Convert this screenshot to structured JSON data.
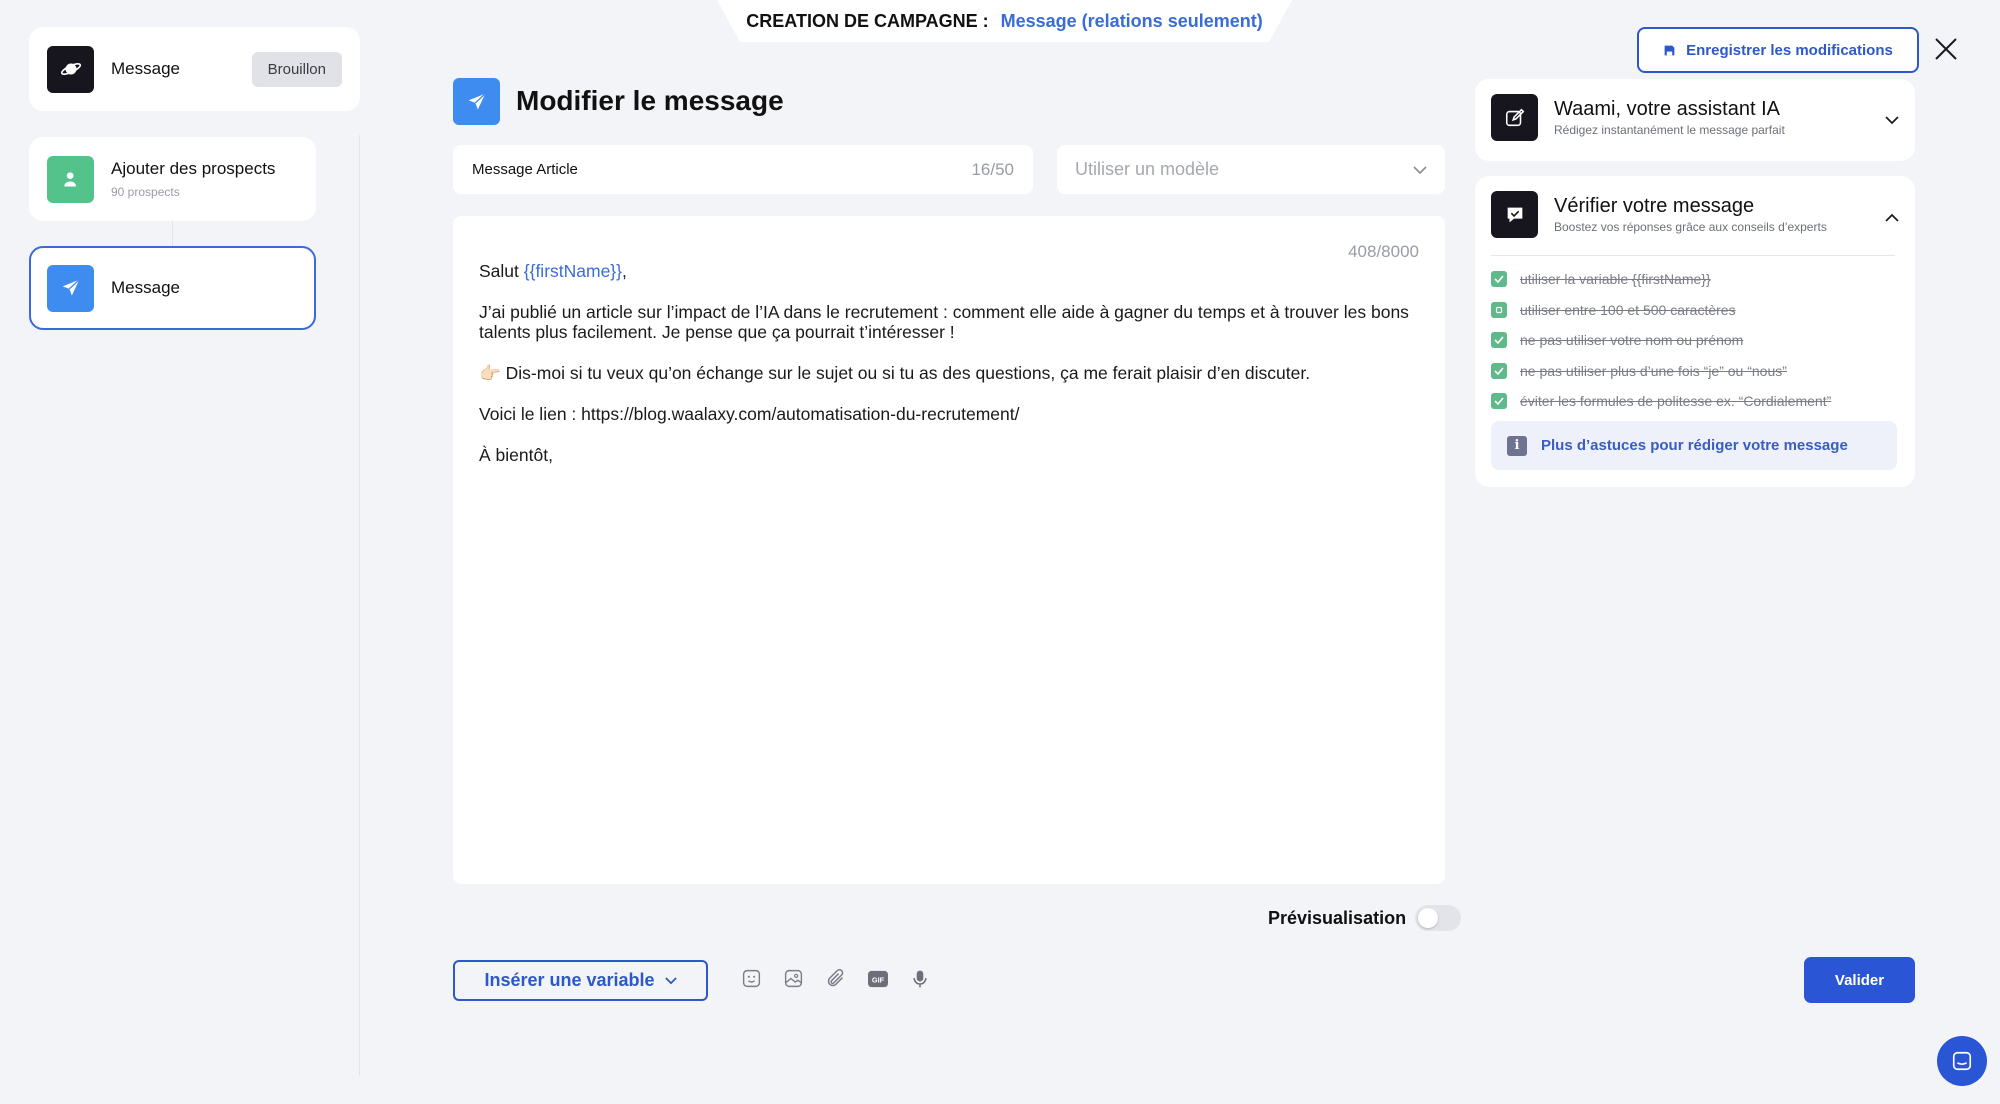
{
  "header": {
    "label": "CREATION DE CAMPAGNE :",
    "value": "Message (relations seulement)"
  },
  "sidebar": {
    "steps": [
      {
        "title": "Message",
        "badge": "Brouillon",
        "icon": "planet-icon"
      },
      {
        "title": "Ajouter des prospects",
        "subtitle": "90 prospects",
        "icon": "user-icon"
      },
      {
        "title": "Message",
        "icon": "send-icon"
      }
    ]
  },
  "editor": {
    "title": "Modifier le message",
    "name_value": "Message Article",
    "name_count": "16/50",
    "template_placeholder": "Utiliser un modèle",
    "char_count": "408/8000",
    "greeting_prefix": "Salut ",
    "greeting_variable": "{{firstName}}",
    "greeting_suffix": ",",
    "paragraph1": "J’ai publié un article sur l’impact de l’IA dans le recrutement : comment elle aide à gagner du temps et à trouver les bons talents plus facilement. Je pense que ça pourrait t’intéresser !",
    "paragraph2": "👉🏻 Dis-moi si tu veux qu’on échange sur le sujet ou si tu as des questions, ça me ferait plaisir d’en discuter.",
    "paragraph3": "Voici le lien : https://blog.waalaxy.com/automatisation-du-recrutement/",
    "paragraph4": "À bientôt,",
    "preview_label": "Prévisualisation",
    "preview_enabled": false,
    "insert_variable_label": "Insérer une variable",
    "validate_label": "Valider",
    "tools": [
      "emoji-icon",
      "image-icon",
      "attachment-icon",
      "gif-icon",
      "microphone-icon"
    ]
  },
  "right_panel": {
    "save_label": "Enregistrer les modifications",
    "assistant": {
      "title": "Waami, votre assistant IA",
      "subtitle": "Rédigez instantanément le message parfait"
    },
    "verify": {
      "title": "Vérifier votre message",
      "subtitle": "Boostez vos réponses grâce aux conseils d’experts",
      "checks": [
        "utiliser la variable {{firstName}}",
        "utiliser entre 100 et 500 caractères",
        "ne pas utiliser votre nom ou prénom",
        "ne pas utiliser plus d’une fois “je” ou “nous”",
        "éviter les formules de politesse ex. “Cordialement”"
      ],
      "tips_label": "Plus d’astuces pour rédiger votre message"
    }
  },
  "colors": {
    "accent": "#2a55d4",
    "link": "#3a6cd8",
    "success": "#5fb98a",
    "step_green": "#54c38b",
    "step_blue": "#3f8cf0"
  }
}
